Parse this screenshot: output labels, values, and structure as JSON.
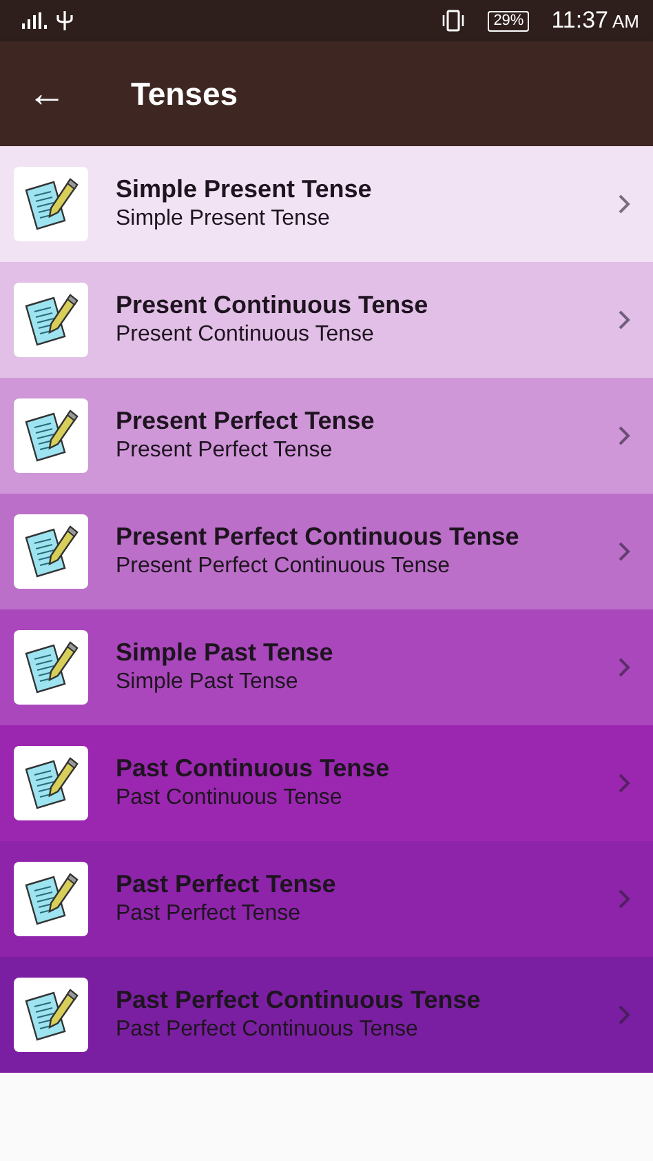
{
  "status_bar": {
    "battery": "29%",
    "time": "11:37",
    "am_pm": "AM"
  },
  "toolbar": {
    "back": "←",
    "title": "Tenses"
  },
  "items": [
    {
      "title": "Simple Present Tense",
      "subtitle": "Simple Present Tense",
      "color": "#f2e3f4"
    },
    {
      "title": "Present Continuous Tense",
      "subtitle": "Present Continuous Tense",
      "color": "#e2bfe6"
    },
    {
      "title": "Present Perfect Tense",
      "subtitle": "Present Perfect Tense",
      "color": "#cf97d8"
    },
    {
      "title": "Present Perfect Continuous Tense",
      "subtitle": "Present Perfect Continuous Tense",
      "color": "#bc6fc9"
    },
    {
      "title": "Simple Past Tense",
      "subtitle": "Simple Past Tense",
      "color": "#aa47bc"
    },
    {
      "title": "Past Continuous Tense",
      "subtitle": "Past Continuous Tense",
      "color": "#9b27b0"
    },
    {
      "title": "Past Perfect Tense",
      "subtitle": "Past Perfect Tense",
      "color": "#8e24aa"
    },
    {
      "title": "Past Perfect Continuous Tense",
      "subtitle": "Past Perfect Continuous Tense",
      "color": "#7b1fa2"
    }
  ]
}
